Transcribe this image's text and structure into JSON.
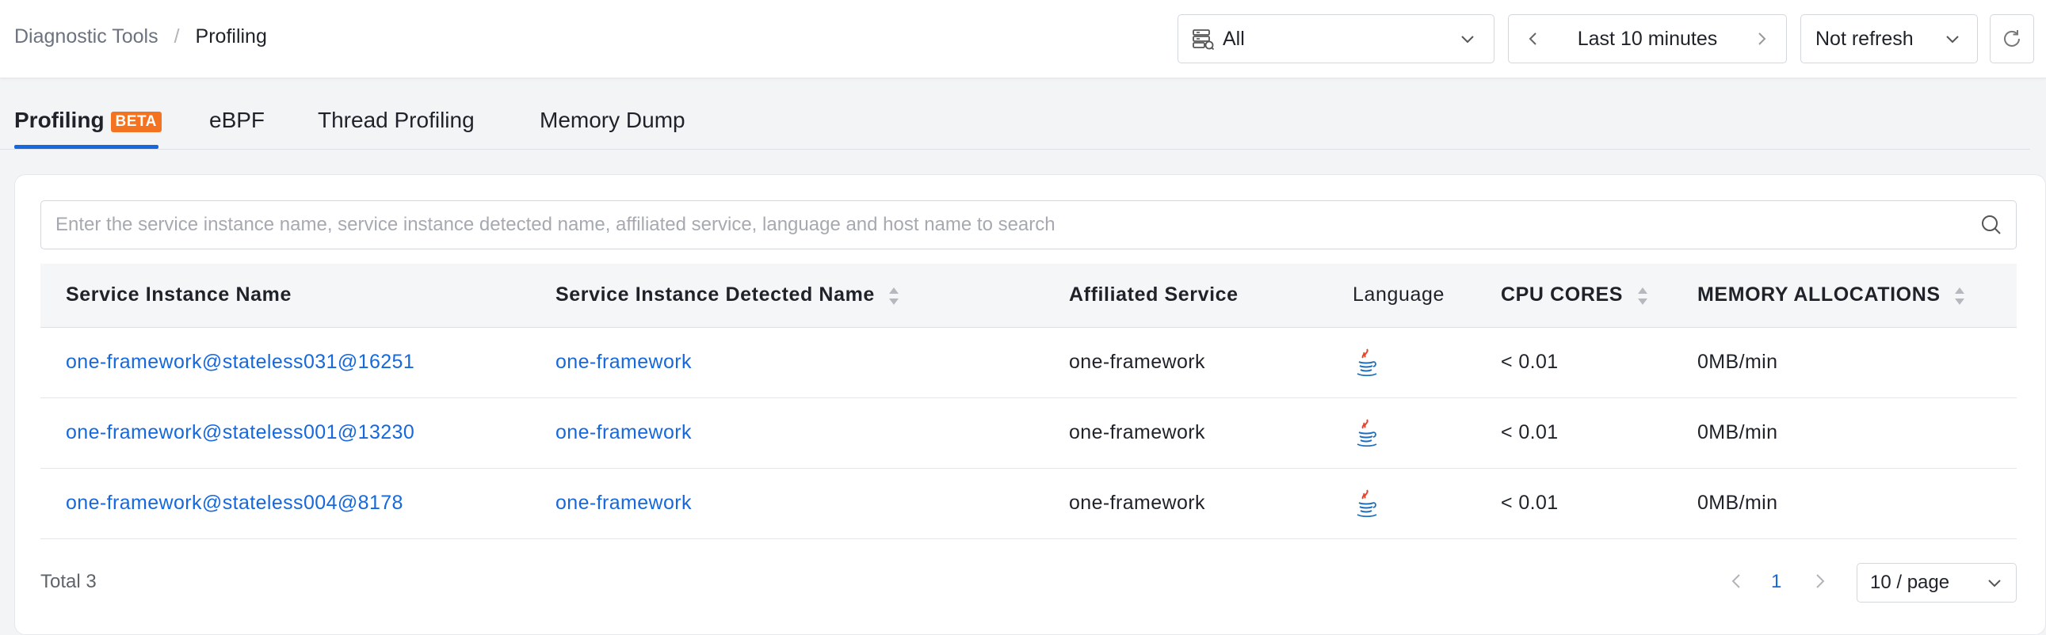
{
  "breadcrumb": {
    "parent": "Diagnostic Tools",
    "separator": "/",
    "current": "Profiling"
  },
  "toolbar": {
    "datasource": "All",
    "time_range": "Last 10 minutes",
    "refresh": "Not refresh"
  },
  "tabs": [
    {
      "label": "Profiling",
      "badge": "BETA",
      "active": true
    },
    {
      "label": "eBPF"
    },
    {
      "label": "Thread Profiling"
    },
    {
      "label": "Memory Dump"
    }
  ],
  "search": {
    "placeholder": "Enter the service instance name, service instance detected name, affiliated service, language and host name to search"
  },
  "table": {
    "columns": [
      "Service Instance Name",
      "Service Instance Detected Name",
      "Affiliated Service",
      "Language",
      "CPU CORES",
      "MEMORY ALLOCATIONS"
    ],
    "rows": [
      {
        "instance": "one-framework@stateless031@16251",
        "detected": "one-framework",
        "service": "one-framework",
        "language": "java-icon",
        "cpu": "< 0.01",
        "memory": "0MB/min"
      },
      {
        "instance": "one-framework@stateless001@13230",
        "detected": "one-framework",
        "service": "one-framework",
        "language": "java-icon",
        "cpu": "< 0.01",
        "memory": "0MB/min"
      },
      {
        "instance": "one-framework@stateless004@8178",
        "detected": "one-framework",
        "service": "one-framework",
        "language": "java-icon",
        "cpu": "< 0.01",
        "memory": "0MB/min"
      }
    ]
  },
  "footer": {
    "total": "Total 3",
    "page": "1",
    "page_size": "10 / page"
  },
  "colors": {
    "accent": "#1668dc",
    "beta_badge": "#f47321",
    "java_red": "#e8412c",
    "java_blue": "#1d6fbf"
  }
}
